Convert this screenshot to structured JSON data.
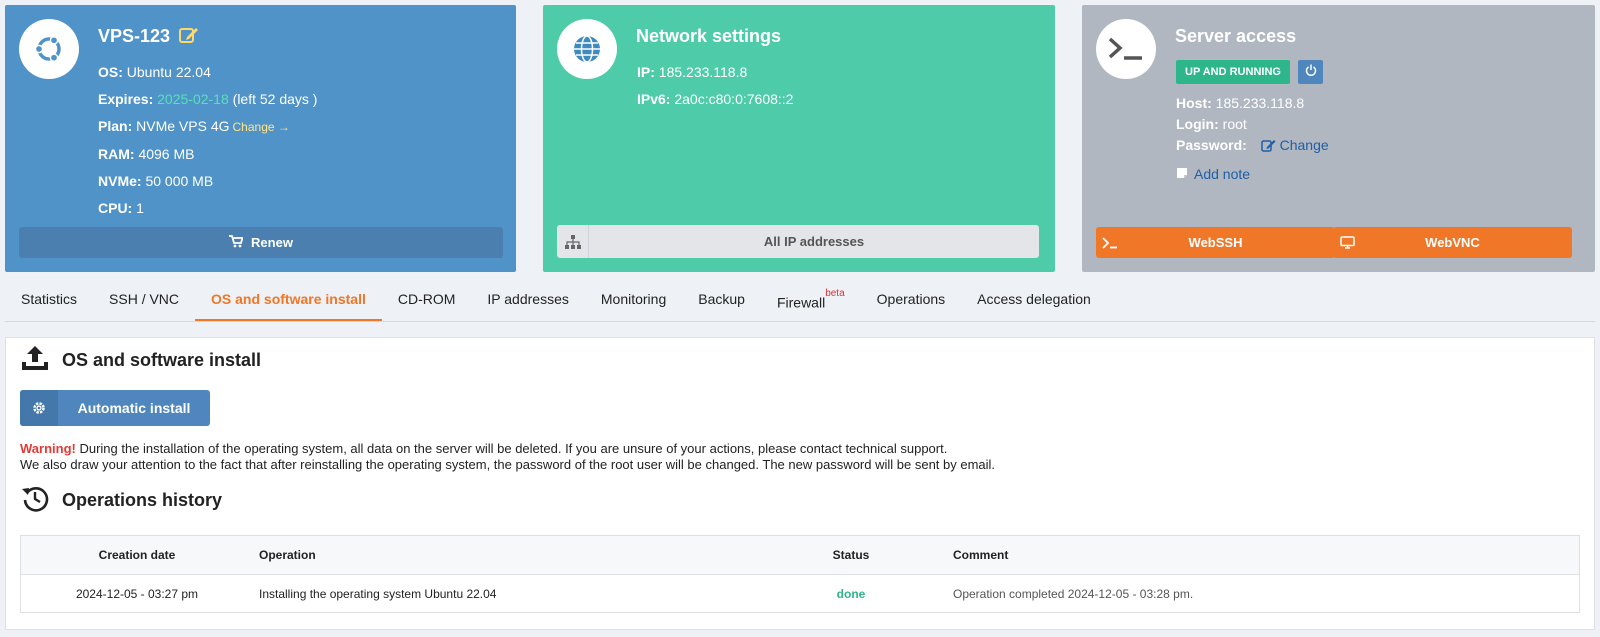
{
  "vps": {
    "title": "VPS-123",
    "os_label": "OS:",
    "os_value": "Ubuntu 22.04",
    "expires_label": "Expires:",
    "expires_date": "2025-02-18",
    "expires_left": "(left 52 days )",
    "plan_label": "Plan:",
    "plan_value": "NVMe VPS 4G",
    "plan_change": "Change →",
    "ram_label": "RAM:",
    "ram_value": "4096 MB",
    "nvme_label": "NVMe:",
    "nvme_value": "50 000 MB",
    "cpu_label": "CPU:",
    "cpu_value": "1",
    "renew_label": "Renew",
    "accent": "#5093c9"
  },
  "network": {
    "title": "Network settings",
    "ip_label": "IP:",
    "ip_value": "185.233.118.8",
    "ipv6_label": "IPv6:",
    "ipv6_value": "2a0c:c80:0:7608::2",
    "all_ip_label": "All IP addresses",
    "accent": "#4ecba9"
  },
  "server": {
    "title": "Server access",
    "status": "UP AND RUNNING",
    "host_label": "Host:",
    "host_value": "185.233.118.8",
    "login_label": "Login:",
    "login_value": "root",
    "password_label": "Password:",
    "password_change": "Change",
    "add_note": "Add note",
    "webssh_label": "WebSSH",
    "webvnc_label": "WebVNC",
    "accent": "#b0b7c1"
  },
  "tabs": [
    {
      "label": "Statistics"
    },
    {
      "label": "SSH / VNC"
    },
    {
      "label": "OS and software install",
      "active": true
    },
    {
      "label": "CD-ROM"
    },
    {
      "label": "IP addresses"
    },
    {
      "label": "Monitoring"
    },
    {
      "label": "Backup"
    },
    {
      "label": "Firewall",
      "sup": "beta"
    },
    {
      "label": "Operations"
    },
    {
      "label": "Access delegation"
    }
  ],
  "install": {
    "title": "OS and software install",
    "auto_label": "Automatic install",
    "warning_word": "Warning!",
    "warning_text": " During the installation of the operating system, all data on the server will be deleted. If you are unsure of your actions, please contact technical support.",
    "warning_text2": "We also draw your attention to the fact that after reinstalling the operating system, the password of the root user will be changed. The new password will be sent by email."
  },
  "history": {
    "title": "Operations history",
    "columns": [
      "Creation date",
      "Operation",
      "Status",
      "Comment"
    ],
    "rows": [
      {
        "date": "2024-12-05 - 03:27 pm",
        "operation": "Installing the operating system Ubuntu 22.04",
        "status": "done",
        "comment": "Operation completed 2024-12-05 - 03:28 pm."
      }
    ]
  }
}
